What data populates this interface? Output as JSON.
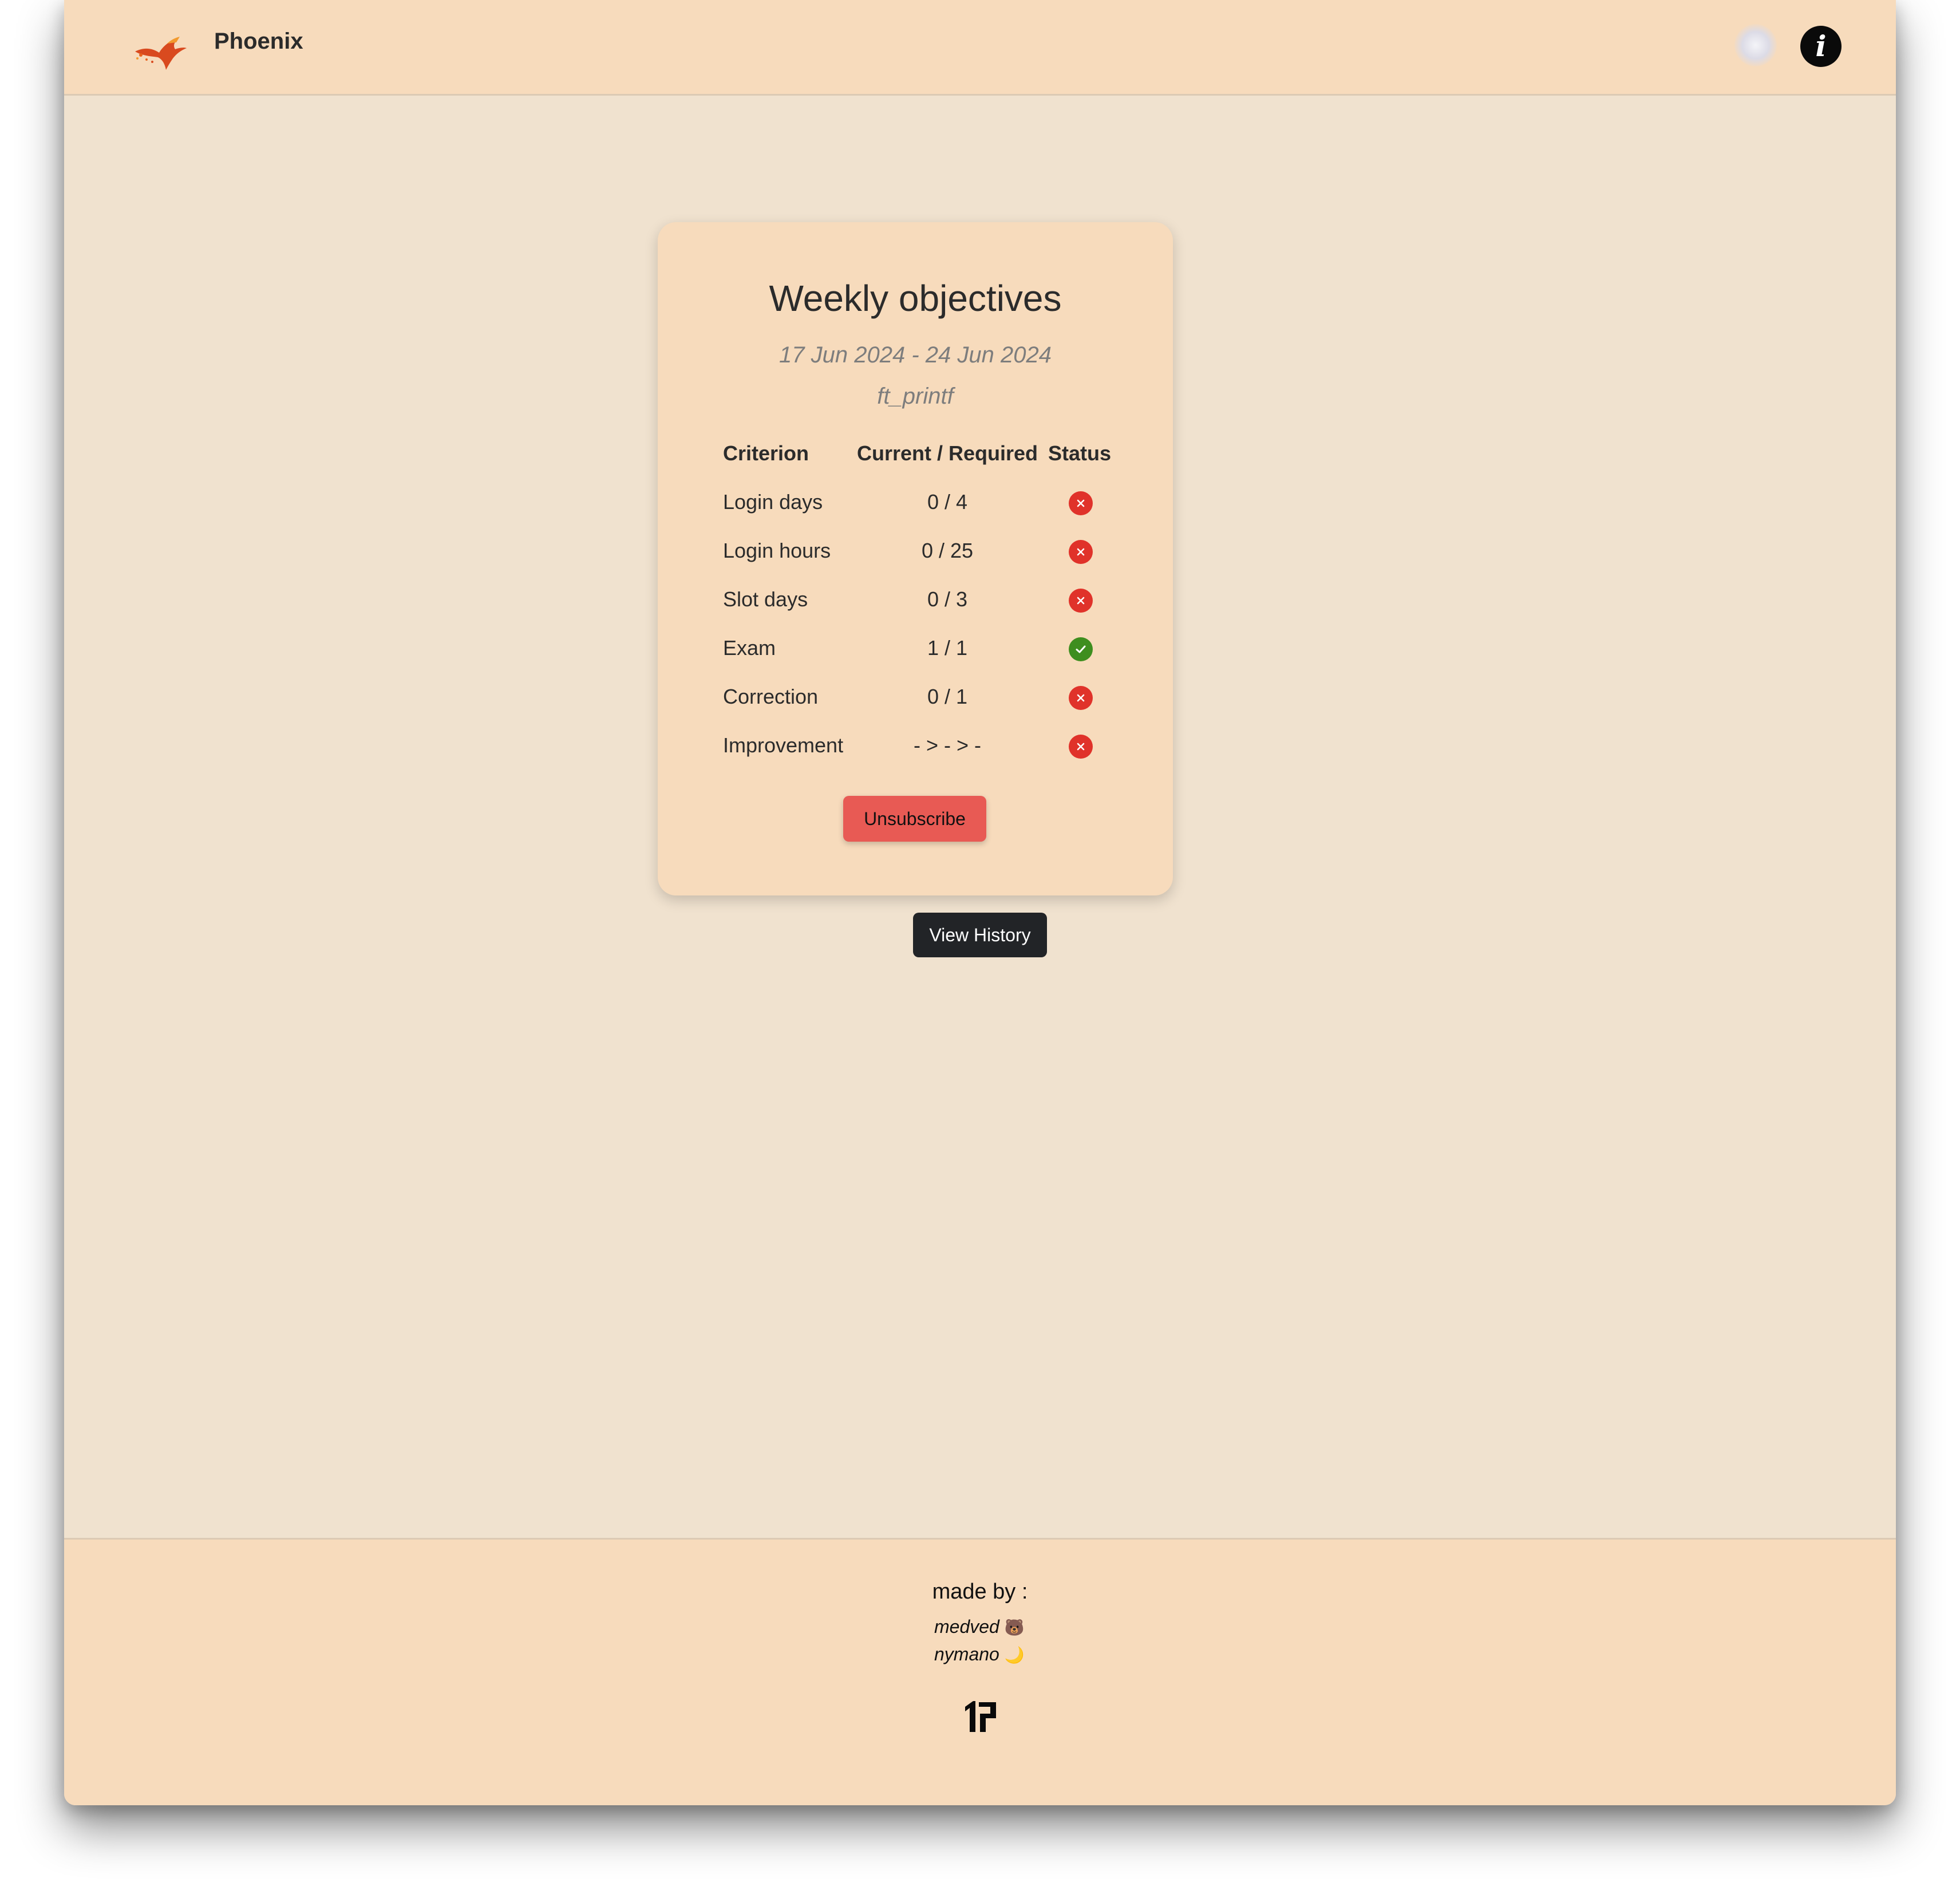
{
  "navbar": {
    "brand": "Phoenix",
    "logo_icon": "phoenix-logo-icon",
    "avatar_icon": "user-avatar",
    "info_icon": "info-icon",
    "info_glyph": "i"
  },
  "objectives": {
    "title": "Weekly objectives",
    "date_range": "17 Jun 2024 - 24 Jun 2024",
    "project": "ft_printf",
    "headers": {
      "criterion": "Criterion",
      "current_required": "Current / Required",
      "status": "Status"
    },
    "rows": [
      {
        "criterion": "Login days",
        "value": "0 / 4",
        "status": "fail"
      },
      {
        "criterion": "Login hours",
        "value": "0 / 25",
        "status": "fail"
      },
      {
        "criterion": "Slot days",
        "value": "0 / 3",
        "status": "fail"
      },
      {
        "criterion": "Exam",
        "value": "1 / 1",
        "status": "pass"
      },
      {
        "criterion": "Correction",
        "value": "0 / 1",
        "status": "fail"
      },
      {
        "criterion": "Improvement",
        "value": "- > - > -",
        "status": "fail"
      }
    ],
    "unsubscribe_label": "Unsubscribe"
  },
  "history": {
    "label": "View History"
  },
  "footer": {
    "made_by": "made by :",
    "authors": [
      {
        "name": "medved",
        "emoji": "🐻"
      },
      {
        "name": "nymano",
        "emoji": "🌙"
      }
    ],
    "school_logo_icon": "school-19-logo-icon"
  },
  "colors": {
    "page_bg": "#f0e2cf",
    "panel_bg": "#f7dbbc",
    "fail": "#e0322a",
    "pass": "#3e8e1f",
    "unsubscribe": "#e85a54",
    "history_button": "#222427"
  }
}
